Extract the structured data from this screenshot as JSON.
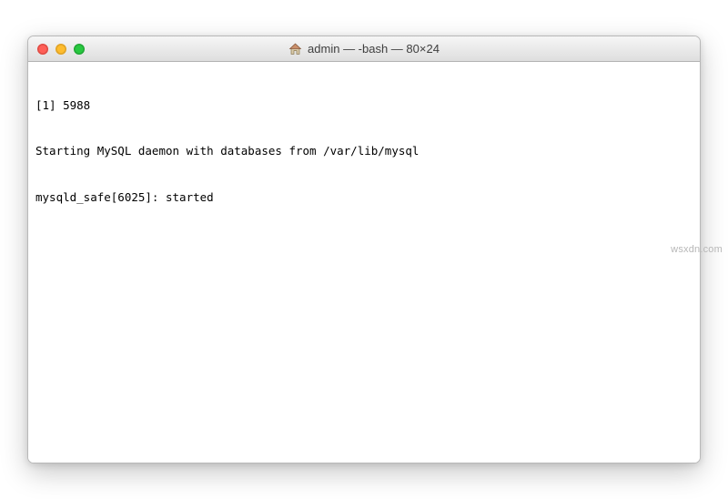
{
  "window": {
    "title": "admin — -bash — 80×24"
  },
  "terminal": {
    "lines": [
      "[1] 5988",
      "Starting MySQL daemon with databases from /var/lib/mysql",
      "mysqld_safe[6025]: started"
    ]
  },
  "watermark": "wsxdn.com"
}
